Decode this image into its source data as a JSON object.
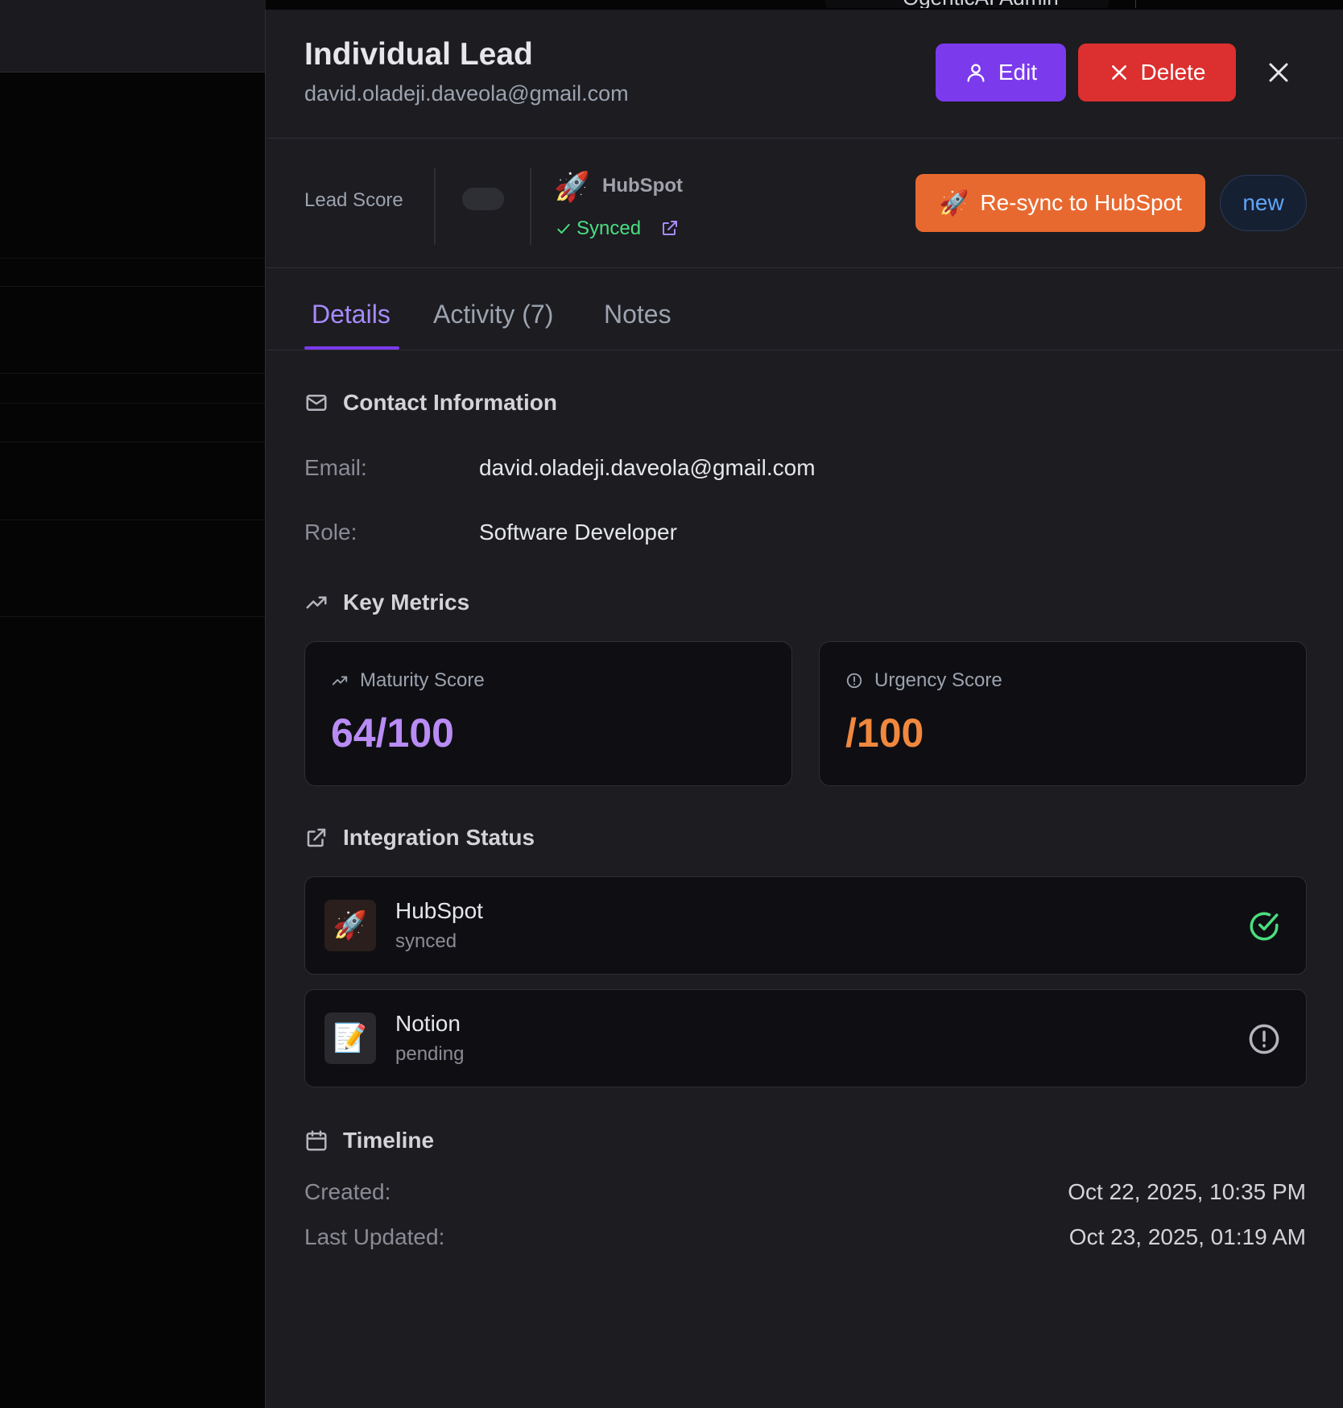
{
  "background": {
    "admin_label": "OgenticAI Admin"
  },
  "lead": {
    "title": "Individual Lead",
    "email_subtitle": "david.oladeji.daveola@gmail.com",
    "edit_label": "Edit",
    "delete_label": "Delete"
  },
  "sync_bar": {
    "lead_score_label": "Lead Score",
    "integration_name": "HubSpot",
    "sync_status": "Synced",
    "resync_label": "Re-sync to HubSpot",
    "status_badge": "new"
  },
  "tabs": [
    {
      "label": "Details",
      "active": true
    },
    {
      "label": "Activity (7)",
      "active": false
    },
    {
      "label": "Notes",
      "active": false
    }
  ],
  "contact": {
    "section_title": "Contact Information",
    "email_label": "Email:",
    "email_value": "david.oladeji.daveola@gmail.com",
    "role_label": "Role:",
    "role_value": "Software Developer"
  },
  "metrics": {
    "section_title": "Key Metrics",
    "maturity_label": "Maturity Score",
    "maturity_value": "64/100",
    "urgency_label": "Urgency Score",
    "urgency_value": "/100"
  },
  "integrations": {
    "section_title": "Integration Status",
    "items": [
      {
        "name": "HubSpot",
        "status": "synced",
        "icon": "rocket-icon",
        "state_icon": "check-circle-icon"
      },
      {
        "name": "Notion",
        "status": "pending",
        "icon": "memo-icon",
        "state_icon": "alert-circle-icon"
      }
    ]
  },
  "timeline": {
    "section_title": "Timeline",
    "created_label": "Created:",
    "created_value": "Oct 22, 2025, 10:35 PM",
    "updated_label": "Last Updated:",
    "updated_value": "Oct 23, 2025, 01:19 AM"
  },
  "colors": {
    "accent_purple": "#7c3aed",
    "delete_red": "#dc2f2f",
    "hubspot_orange": "#e8692f",
    "synced_green": "#4ade80",
    "maturity_purple": "#b98cf5",
    "urgency_orange": "#f0883e"
  }
}
